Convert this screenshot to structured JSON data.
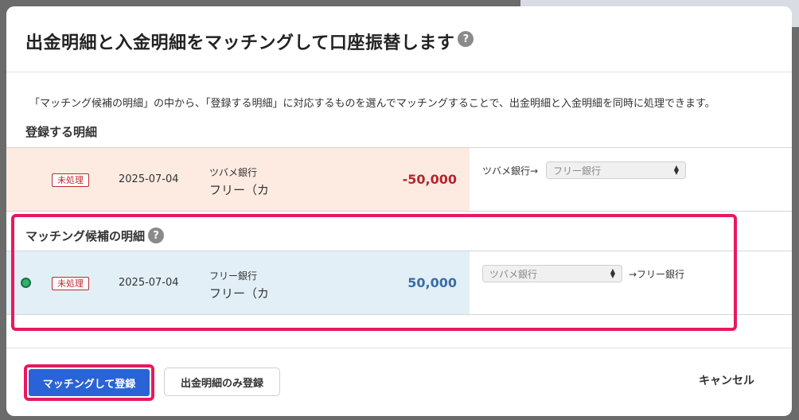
{
  "modal": {
    "title": "出金明細と入金明細をマッチングして口座振替します",
    "help_glyph": "?",
    "description": "「マッチング候補の明細」の中から、「登録する明細」に対応するものを選んでマッチングすることで、出金明細と入金明細を同時に処理できます。"
  },
  "register_section": {
    "label": "登録する明細",
    "row": {
      "status": "未処理",
      "date": "2025-07-04",
      "bank": "ツバメ銀行",
      "name": "フリー（カ",
      "amount": "-50,000",
      "transfer_from": "ツバメ銀行→",
      "select_value": "フリー銀行"
    }
  },
  "candidate_section": {
    "label": "マッチング候補の明細",
    "help_glyph": "?",
    "row": {
      "status": "未処理",
      "date": "2025-07-04",
      "bank": "フリー銀行",
      "name": "フリー（カ",
      "amount": "50,000",
      "select_value": "ツバメ銀行",
      "transfer_to": "→フリー銀行"
    }
  },
  "footer": {
    "primary_button": "マッチングして登録",
    "secondary_button": "出金明細のみ登録",
    "cancel_button": "キャンセル"
  },
  "colors": {
    "highlight": "#e8185f",
    "primary": "#2a63d6",
    "negative_amount": "#b3262b",
    "positive_amount": "#3a6ea5",
    "register_row_bg": "#fdebe1",
    "candidate_row_bg": "#e2eff7"
  }
}
